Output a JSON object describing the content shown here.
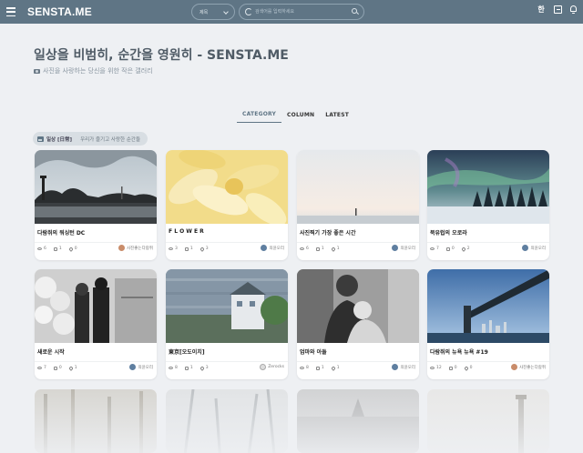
{
  "topbar": {
    "logo": "SENSTA.ME",
    "search_select": "제목",
    "search_placeholder": "검색어를 입력하세요",
    "lang": "한"
  },
  "header": {
    "title": "일상을 비범히, 순간을 영원히 - SENSTA.ME",
    "subtitle": "사진을 사랑하는 당신을 위한 작은 갤러리"
  },
  "tabs": [
    {
      "label": "CATEGORY"
    },
    {
      "label": "COLUMN"
    },
    {
      "label": "LATEST"
    }
  ],
  "category": {
    "label": "일상 [日常]",
    "desc": "우리가 즐기고 사랑한 순간들"
  },
  "cards": [
    {
      "title": "다람쥐의 워싱턴 DC",
      "views": "6",
      "comments": "1",
      "likes": "0",
      "author": "사진좋는다람쥐"
    },
    {
      "title": "F L O W E R",
      "views": "3",
      "comments": "1",
      "likes": "3",
      "author": "의윤오리"
    },
    {
      "title": "사진찍기 가장 좋은 시간",
      "views": "6",
      "comments": "1",
      "likes": "1",
      "author": "의윤오리"
    },
    {
      "title": "북유럽의 오로라",
      "views": "7",
      "comments": "0",
      "likes": "2",
      "author": "의윤오리"
    },
    {
      "title": "새로운 시작",
      "views": "7",
      "comments": "0",
      "likes": "1",
      "author": "의윤오리"
    },
    {
      "title": "東京[오도이치]",
      "views": "8",
      "comments": "1",
      "likes": "3",
      "author": "Zerocks"
    },
    {
      "title": "엄마와 아들",
      "views": "8",
      "comments": "1",
      "likes": "1",
      "author": "의윤오리"
    },
    {
      "title": "다람쥐의 뉴욕 뉴욕 #19",
      "views": "12",
      "comments": "0",
      "likes": "0",
      "author": "사진좋는다람쥐"
    }
  ],
  "colors": {
    "topbar": "#5f7585",
    "background": "#eef0f3"
  }
}
